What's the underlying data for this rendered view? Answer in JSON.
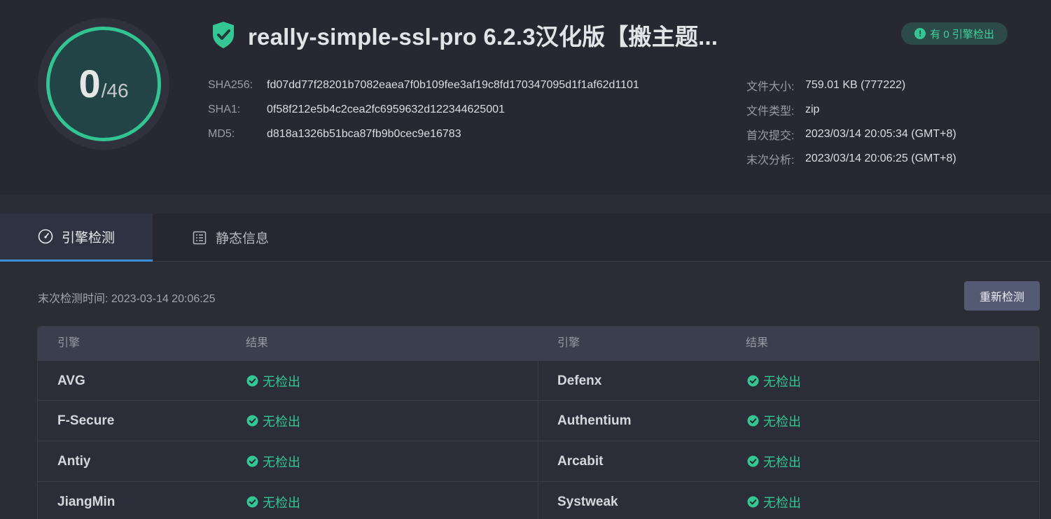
{
  "score": {
    "detected": "0",
    "total": "/46"
  },
  "title": "really-simple-ssl-pro 6.2.3汉化版【搬主题...",
  "badge": {
    "icon": "alert-icon",
    "text": "有 0 引擎检出"
  },
  "hashes": [
    {
      "label": "SHA256:",
      "value": "fd07dd77f28201b7082eaea7f0b109fee3af19c8fd170347095d1f1af62d1101"
    },
    {
      "label": "SHA1:",
      "value": "0f58f212e5b4c2cea2fc6959632d122344625001"
    },
    {
      "label": "MD5:",
      "value": "d818a1326b51bca87fb9b0cec9e16783"
    }
  ],
  "meta": [
    {
      "label": "文件大小:",
      "value": "759.01 KB (777222)"
    },
    {
      "label": "文件类型:",
      "value": "zip"
    },
    {
      "label": "首次提交:",
      "value": "2023/03/14 20:05:34 (GMT+8)"
    },
    {
      "label": "末次分析:",
      "value": "2023/03/14 20:06:25 (GMT+8)"
    }
  ],
  "tabs": [
    {
      "label": "引擎检测",
      "icon": "gauge-icon"
    },
    {
      "label": "静态信息",
      "icon": "document-list-icon"
    }
  ],
  "last_check": "末次检测时间: 2023-03-14 20:06:25",
  "recheck_label": "重新检测",
  "table": {
    "headers": [
      "引擎",
      "结果",
      "引擎",
      "结果"
    ],
    "rows": [
      {
        "left": {
          "engine": "AVG",
          "result": "无检出"
        },
        "right": {
          "engine": "Defenx",
          "result": "无检出"
        }
      },
      {
        "left": {
          "engine": "F-Secure",
          "result": "无检出"
        },
        "right": {
          "engine": "Authentium",
          "result": "无检出"
        }
      },
      {
        "left": {
          "engine": "Antiy",
          "result": "无检出"
        },
        "right": {
          "engine": "Arcabit",
          "result": "无检出"
        }
      },
      {
        "left": {
          "engine": "JiangMin",
          "result": "无检出"
        },
        "right": {
          "engine": "Systweak",
          "result": "无检出"
        }
      }
    ]
  },
  "colors": {
    "accent_green": "#33c494",
    "tab_underline": "#3d8fd8",
    "button_bg": "#545a73"
  }
}
